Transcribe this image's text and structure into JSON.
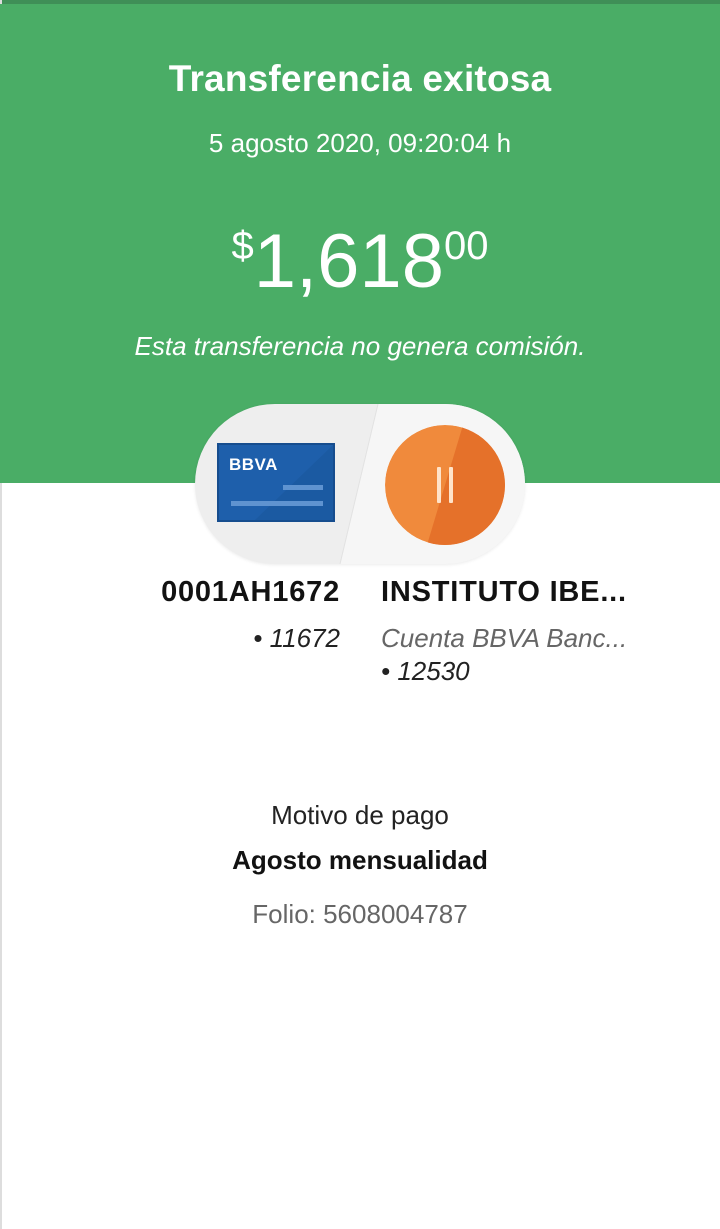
{
  "header": {
    "title": "Transferencia exitosa",
    "datetime": "5 agosto 2020, 09:20:04 h",
    "amount": {
      "currency": "$",
      "integer": "1,618",
      "cents": "00"
    },
    "note": "Esta transferencia no genera comisión.",
    "color": "#4aad66"
  },
  "origin": {
    "card_brand": "BBVA",
    "name": "0001AH1672",
    "number": "• 11672",
    "card_color": "#1e5fab"
  },
  "destination": {
    "name": "INSTITUTO IBE...",
    "bank": "Cuenta BBVA Banc...",
    "number": "• 12530",
    "avatar_color": "#f08a3c",
    "icon": "pause-icon"
  },
  "details": {
    "motivo_label": "Motivo de pago",
    "motivo_value": "Agosto mensualidad",
    "folio": "Folio: 5608004787"
  }
}
